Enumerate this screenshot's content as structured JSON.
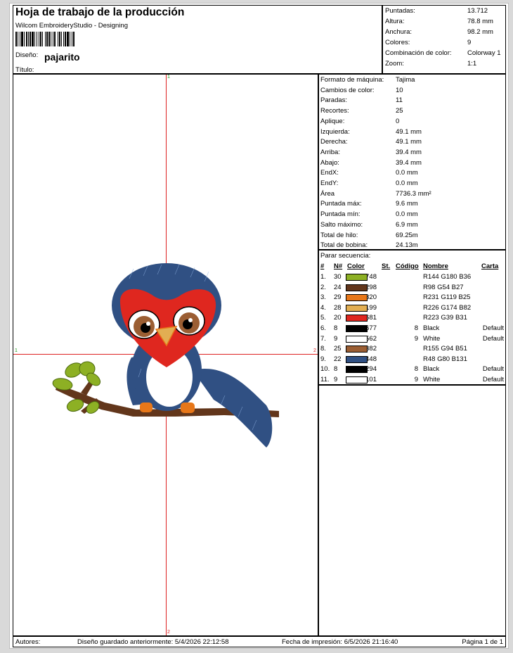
{
  "header": {
    "title": "Hoja de trabajo de la producción",
    "app": "Wilcom EmbroideryStudio - Designing",
    "design_label": "Diseño:",
    "design_name": "pajarito",
    "title_label": "Título:"
  },
  "summary": [
    {
      "label": "Puntadas:",
      "value": "13.712"
    },
    {
      "label": "Altura:",
      "value": "78.8 mm"
    },
    {
      "label": "Anchura:",
      "value": "98.2 mm"
    },
    {
      "label": "Colores:",
      "value": "9"
    },
    {
      "label": "Combinación de color:",
      "value": "Colorway 1"
    },
    {
      "label": "Zoom:",
      "value": "1:1"
    }
  ],
  "axis_labels": {
    "top": "1",
    "left": "1",
    "right": "2",
    "bottom": "2"
  },
  "stats": [
    {
      "label": "Formato de máquina:",
      "value": "Tajima"
    },
    {
      "label": "Cambios de color:",
      "value": "10"
    },
    {
      "label": "Paradas:",
      "value": "11"
    },
    {
      "label": "Recortes:",
      "value": "25"
    },
    {
      "label": "Aplique:",
      "value": "0"
    },
    {
      "label": "Izquierda:",
      "value": "49.1 mm"
    },
    {
      "label": "Derecha:",
      "value": "49.1 mm"
    },
    {
      "label": "Arriba:",
      "value": "39.4 mm"
    },
    {
      "label": "Abajo:",
      "value": "39.4 mm"
    },
    {
      "label": "EndX:",
      "value": "0.0 mm"
    },
    {
      "label": "EndY:",
      "value": "0.0 mm"
    },
    {
      "label": "Área",
      "value": "7736.3 mm²"
    },
    {
      "label": "Puntada máx:",
      "value": "9.6 mm"
    },
    {
      "label": "Puntada mín:",
      "value": "0.0 mm"
    },
    {
      "label": "Salto máximo:",
      "value": "6.9 mm"
    },
    {
      "label": "Total de hilo:",
      "value": "69.25m"
    },
    {
      "label": "Total de bobina:",
      "value": "24.13m"
    }
  ],
  "sequence": {
    "title": "Parar secuencia:",
    "headers": {
      "num": "#",
      "n": "N#",
      "color": "Color",
      "st": "St.",
      "code": "Código",
      "name": "Nombre",
      "chart": "Carta"
    },
    "rows": [
      {
        "num": "1.",
        "n": "30",
        "color": "#8db024",
        "st": "748",
        "code": "",
        "name": "R144 G180 B36",
        "chart": ""
      },
      {
        "num": "2.",
        "n": "24",
        "color": "#62361b",
        "st": "1.298",
        "code": "",
        "name": "R98 G54 B27",
        "chart": ""
      },
      {
        "num": "3.",
        "n": "29",
        "color": "#e77719",
        "st": "320",
        "code": "",
        "name": "R231 G119 B25",
        "chart": ""
      },
      {
        "num": "4.",
        "n": "28",
        "color": "#e2ae52",
        "st": "199",
        "code": "",
        "name": "R226 G174 B82",
        "chart": ""
      },
      {
        "num": "5.",
        "n": "20",
        "color": "#df271f",
        "st": "1.681",
        "code": "",
        "name": "R223 G39 B31",
        "chart": ""
      },
      {
        "num": "6.",
        "n": "8",
        "color": "#000000",
        "st": "677",
        "code": "8",
        "name": "Black",
        "chart": "Default"
      },
      {
        "num": "7.",
        "n": "9",
        "color": "#ffffff",
        "st": "1.562",
        "code": "9",
        "name": "White",
        "chart": "Default"
      },
      {
        "num": "8.",
        "n": "25",
        "color": "#9b5e33",
        "st": "382",
        "code": "",
        "name": "R155 G94 B51",
        "chart": ""
      },
      {
        "num": "9.",
        "n": "22",
        "color": "#305083",
        "st": "4.448",
        "code": "",
        "name": "R48 G80 B131",
        "chart": ""
      },
      {
        "num": "10.",
        "n": "8",
        "color": "#000000",
        "st": "2.294",
        "code": "8",
        "name": "Black",
        "chart": "Default"
      },
      {
        "num": "11.",
        "n": "9",
        "color": "#ffffff",
        "st": "101",
        "code": "9",
        "name": "White",
        "chart": "Default"
      }
    ]
  },
  "footer": {
    "authors": "Autores:",
    "saved": "Diseño guardado anteriormente: 5/4/2026 22:12:58",
    "printed": "Fecha de impresión: 6/5/2026 21:16:40",
    "page": "Página 1 de 1"
  }
}
